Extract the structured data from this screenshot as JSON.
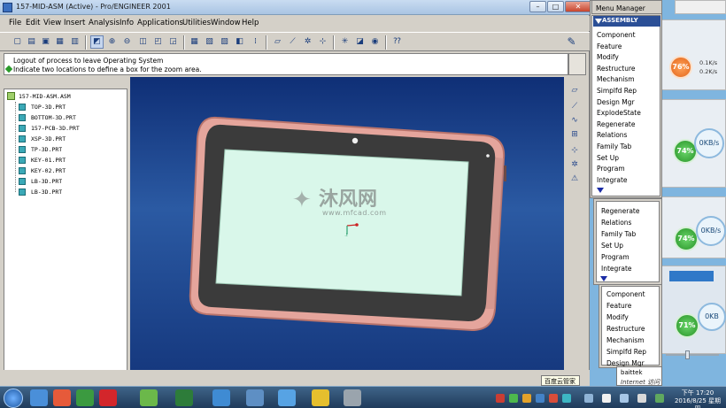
{
  "window": {
    "title": "157-MID-ASM (Active) - Pro/ENGINEER 2001",
    "min": "–",
    "max": "□",
    "close": "✕"
  },
  "menu": [
    "File",
    "Edit",
    "View",
    "Insert",
    "Analysis",
    "Info",
    "Applications",
    "Utilities",
    "Window",
    "Help"
  ],
  "messages": {
    "line1": "Logout of process to leave Operating System",
    "line2": "Indicate two locations to define a box for the zoom area."
  },
  "model_tree": {
    "root": "157-MID-ASM.ASM",
    "parts": [
      "TOP-3D.PRT",
      "BOTTOM-3D.PRT",
      "157-PCB-3D.PRT",
      "XSP-3D.PRT",
      "TP-3D.PRT",
      "KEY-01.PRT",
      "KEY-02.PRT",
      "LB-3D.PRT",
      "LB-3D.PRT"
    ]
  },
  "watermark": {
    "brand_cn": "沐风网",
    "url": "www.mfcad.com"
  },
  "menu_manager": {
    "title": "Menu Manager",
    "section": "ASSEMBLY",
    "panel1": [
      "Component",
      "Feature",
      "Modify",
      "Restructure",
      "Mechanism",
      "Simplfd Rep",
      "Design Mgr",
      "ExplodeState",
      "Regenerate",
      "Relations",
      "Family Tab",
      "Set Up",
      "Program",
      "Integrate"
    ],
    "panel2": [
      "Regenerate",
      "Relations",
      "Family Tab",
      "Set Up",
      "Program",
      "Integrate"
    ],
    "panel3": [
      "Component",
      "Feature",
      "Modify",
      "Restructure",
      "Mechanism",
      "Simplfd Rep",
      "Design Mgr"
    ]
  },
  "widgets": {
    "gauge1": "76%",
    "up": "0.1K/s",
    "down": "0.2K/s",
    "gauge2": "74%",
    "kb2": "0KB/s",
    "gauge3": "74%",
    "kb3": "0KB/s",
    "gauge4": "71%",
    "kb4": "0KB"
  },
  "tooltip": {
    "title": "baittek",
    "subtitle": "Internet 访问"
  },
  "side_tip": "百度云管家",
  "clock": {
    "time": "下午 17:20",
    "date": "2016/8/25 星期四"
  },
  "colors": {
    "viewport_top": "#0f2f76",
    "tablet_frame": "#e8a8a0",
    "screen": "#d9f7ea",
    "bezel": "#3b3b3b",
    "menu_header": "#2b4f96"
  }
}
